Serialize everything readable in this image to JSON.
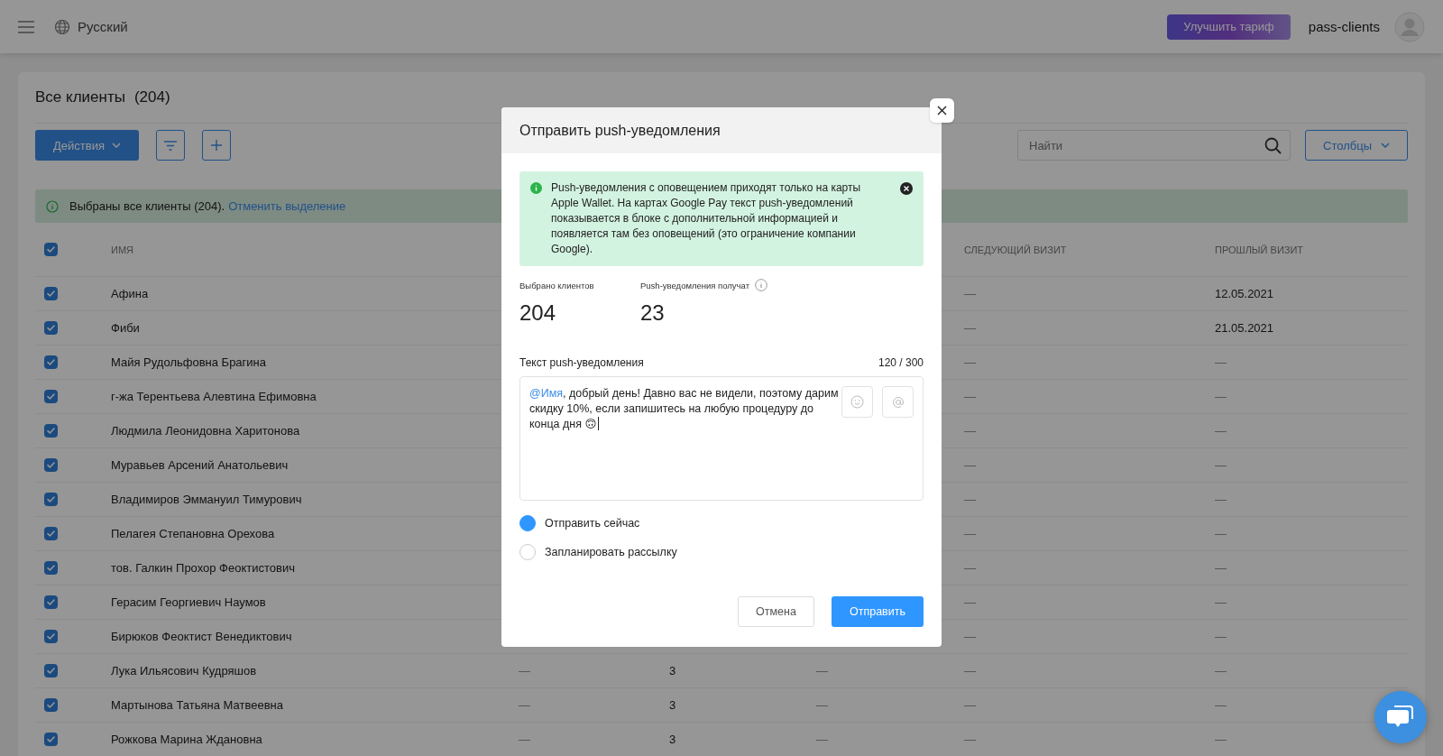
{
  "top_bar": {
    "language": "Русский",
    "upgrade_button": "Улучшить тариф",
    "account": "pass-clients"
  },
  "clients": {
    "title": "Все клиенты",
    "count": "(204)",
    "actions_button": "Действия",
    "search": {
      "placeholder": "Найти"
    },
    "columns_button": "Столбцы",
    "selection_notice": {
      "text": "Выбраны все клиенты (204).",
      "link": "Отменить выделение"
    },
    "table": {
      "all_checked": true,
      "columns": {
        "name": "ИМЯ",
        "next_visit": "СЛЕДУЮЩИЙ ВИЗИТ",
        "last_visit": "ПРОШЛЫЙ ВИЗИТ"
      },
      "rows": [
        {
          "checked": true,
          "name": "Афина",
          "next_visit": "—",
          "last_visit": "12.05.2021"
        },
        {
          "checked": true,
          "name": "Фиби",
          "next_visit": "—",
          "last_visit": "21.05.2021"
        },
        {
          "checked": true,
          "name": "Майя Рудольфовна Брагина",
          "next_visit": "—",
          "last_visit": "—"
        },
        {
          "checked": true,
          "name": "г-жа Терентьева Алевтина Ефимовна",
          "next_visit": "—",
          "last_visit": "—"
        },
        {
          "checked": true,
          "name": "Людмила Леонидовна Харитонова",
          "next_visit": "—",
          "last_visit": "—"
        },
        {
          "checked": true,
          "name": "Муравьев Арсений Анатольевич",
          "next_visit": "—",
          "last_visit": "—"
        },
        {
          "checked": true,
          "name": "Владимиров Эммануил Тимурович",
          "next_visit": "—",
          "last_visit": "—"
        },
        {
          "checked": true,
          "name": "Пелагея Степановна Орехова",
          "next_visit": "—",
          "last_visit": "—"
        },
        {
          "checked": true,
          "name": "тов. Галкин Прохор Феоктистович",
          "next_visit": "—",
          "last_visit": "—"
        },
        {
          "checked": true,
          "name": "Герасим Георгиевич Наумов",
          "next_visit": "—",
          "last_visit": "—"
        },
        {
          "checked": true,
          "name": "Бирюков Феоктист Венедиктович",
          "next_visit": "—",
          "last_visit": "—"
        },
        {
          "checked": true,
          "name": "Лука Ильясович Кудряшов",
          "column_3": "—",
          "column_4": "3",
          "column_5": "—",
          "next_visit": "—",
          "last_visit": "—"
        },
        {
          "checked": true,
          "name": "Мартынова Татьяна Матвеевна",
          "column_3": "—",
          "column_4": "3",
          "column_5": "—",
          "next_visit": "—",
          "last_visit": "—"
        },
        {
          "checked": true,
          "name": "Рожкова Марина Ждановна",
          "column_3": "—",
          "column_4": "3",
          "column_5": "—",
          "next_visit": "—",
          "last_visit": "—"
        }
      ]
    }
  },
  "modal": {
    "title": "Отправить push-уведомления",
    "notice": "Push-уведомления с оповещением приходят только на карты Apple Wallet. На картах Google Pay текст push-уведомлений показывается в блоке с дополнительной информацией и появляется там без оповещений (это ограничение компании Google).",
    "stats": [
      {
        "label": "Выбрано клиентов",
        "value": "204",
        "info": false
      },
      {
        "label": "Push-уведомления получат",
        "value": "23",
        "info": true
      }
    ],
    "message": {
      "label": "Текст push-уведомления",
      "counter": "120 / 300",
      "mention": "@Имя",
      "text": ", добрый день! Давно вас не видели, поэтому дарим скидку 10%, если запишитесь на любую процедуру до конца дня 🙃"
    },
    "send_options": [
      {
        "label": "Отправить сейчас",
        "selected": true
      },
      {
        "label": "Запланировать рассылку",
        "selected": false
      }
    ],
    "cancel_button": "Отмена",
    "send_button": "Отправить"
  }
}
